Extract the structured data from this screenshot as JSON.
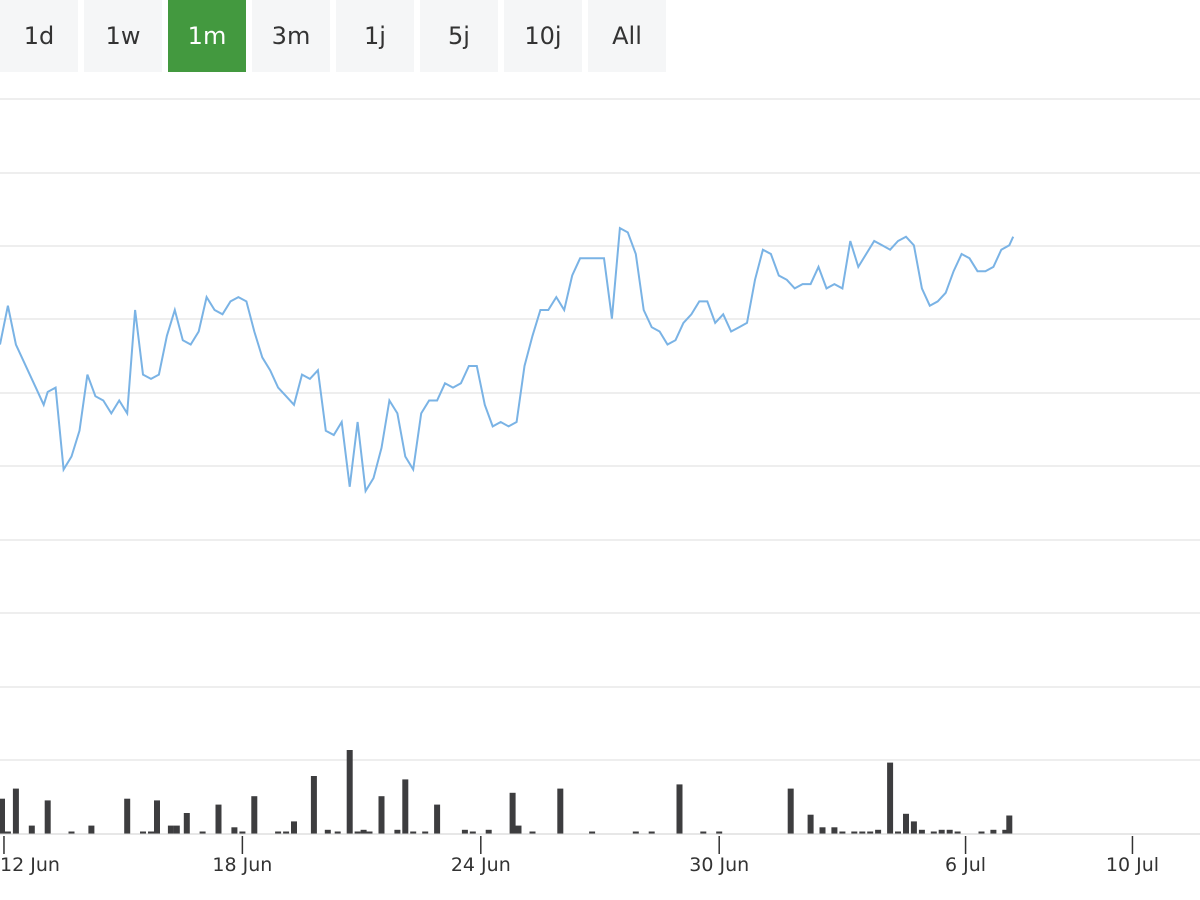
{
  "range_selector": {
    "buttons": [
      "1d",
      "1w",
      "1m",
      "3m",
      "1j",
      "5j",
      "10j",
      "All"
    ],
    "selected": "1m"
  },
  "colors": {
    "line": "#7ab3e5",
    "volume": "#3d3d3f",
    "selected_button": "#43993f",
    "button_bg": "#f5f6f7",
    "grid": "#e4e4e4"
  },
  "chart_data": [
    {
      "type": "line",
      "x_unit": "day",
      "xlim": [
        11.9,
        42.1
      ],
      "ylim": [
        0,
        10
      ],
      "grid": true,
      "x_ticks": [
        {
          "day": 12,
          "label": "12 Jun"
        },
        {
          "day": 18,
          "label": "18 Jun"
        },
        {
          "day": 24,
          "label": "24 Jun"
        },
        {
          "day": 30,
          "label": "30 Jun"
        },
        {
          "day": 36.2,
          "label": "6 Jul"
        },
        {
          "day": 40.4,
          "label": "10 Jul"
        }
      ],
      "series": [
        {
          "points": [
            [
              11.9,
              6.3
            ],
            [
              12.1,
              7.2
            ],
            [
              12.3,
              6.3
            ],
            [
              12.6,
              5.7
            ],
            [
              12.8,
              5.3
            ],
            [
              13.0,
              4.9
            ],
            [
              13.1,
              5.2
            ],
            [
              13.3,
              5.3
            ],
            [
              13.5,
              3.4
            ],
            [
              13.7,
              3.7
            ],
            [
              13.9,
              4.3
            ],
            [
              14.1,
              5.6
            ],
            [
              14.3,
              5.1
            ],
            [
              14.5,
              5.0
            ],
            [
              14.7,
              4.7
            ],
            [
              14.9,
              5.0
            ],
            [
              15.1,
              4.7
            ],
            [
              15.3,
              7.1
            ],
            [
              15.5,
              5.6
            ],
            [
              15.7,
              5.5
            ],
            [
              15.9,
              5.6
            ],
            [
              16.1,
              6.5
            ],
            [
              16.3,
              7.1
            ],
            [
              16.5,
              6.4
            ],
            [
              16.7,
              6.3
            ],
            [
              16.9,
              6.6
            ],
            [
              17.1,
              7.4
            ],
            [
              17.3,
              7.1
            ],
            [
              17.5,
              7.0
            ],
            [
              17.7,
              7.3
            ],
            [
              17.9,
              7.4
            ],
            [
              18.1,
              7.3
            ],
            [
              18.3,
              6.6
            ],
            [
              18.5,
              6.0
            ],
            [
              18.7,
              5.7
            ],
            [
              18.9,
              5.3
            ],
            [
              19.1,
              5.1
            ],
            [
              19.3,
              4.9
            ],
            [
              19.5,
              5.6
            ],
            [
              19.7,
              5.5
            ],
            [
              19.9,
              5.7
            ],
            [
              20.1,
              4.3
            ],
            [
              20.3,
              4.2
            ],
            [
              20.5,
              4.5
            ],
            [
              20.7,
              3.0
            ],
            [
              20.9,
              4.5
            ],
            [
              21.1,
              2.9
            ],
            [
              21.3,
              3.2
            ],
            [
              21.5,
              3.9
            ],
            [
              21.7,
              5.0
            ],
            [
              21.9,
              4.7
            ],
            [
              22.1,
              3.7
            ],
            [
              22.3,
              3.4
            ],
            [
              22.5,
              4.7
            ],
            [
              22.7,
              5.0
            ],
            [
              22.9,
              5.0
            ],
            [
              23.1,
              5.4
            ],
            [
              23.3,
              5.3
            ],
            [
              23.5,
              5.4
            ],
            [
              23.7,
              5.8
            ],
            [
              23.9,
              5.8
            ],
            [
              24.1,
              4.9
            ],
            [
              24.3,
              4.4
            ],
            [
              24.5,
              4.5
            ],
            [
              24.7,
              4.4
            ],
            [
              24.9,
              4.5
            ],
            [
              25.1,
              5.8
            ],
            [
              25.3,
              6.5
            ],
            [
              25.5,
              7.1
            ],
            [
              25.7,
              7.1
            ],
            [
              25.9,
              7.4
            ],
            [
              26.1,
              7.1
            ],
            [
              26.3,
              7.9
            ],
            [
              26.5,
              8.3
            ],
            [
              26.7,
              8.3
            ],
            [
              26.9,
              8.3
            ],
            [
              27.1,
              8.3
            ],
            [
              27.3,
              6.9
            ],
            [
              27.5,
              9.0
            ],
            [
              27.7,
              8.9
            ],
            [
              27.9,
              8.4
            ],
            [
              28.1,
              7.1
            ],
            [
              28.3,
              6.7
            ],
            [
              28.5,
              6.6
            ],
            [
              28.7,
              6.3
            ],
            [
              28.9,
              6.4
            ],
            [
              29.1,
              6.8
            ],
            [
              29.3,
              7.0
            ],
            [
              29.5,
              7.3
            ],
            [
              29.7,
              7.3
            ],
            [
              29.9,
              6.8
            ],
            [
              30.1,
              7.0
            ],
            [
              30.3,
              6.6
            ],
            [
              30.5,
              6.7
            ],
            [
              30.7,
              6.8
            ],
            [
              30.9,
              7.8
            ],
            [
              31.1,
              8.5
            ],
            [
              31.3,
              8.4
            ],
            [
              31.5,
              7.9
            ],
            [
              31.7,
              7.8
            ],
            [
              31.9,
              7.6
            ],
            [
              32.1,
              7.7
            ],
            [
              32.3,
              7.7
            ],
            [
              32.5,
              8.1
            ],
            [
              32.7,
              7.6
            ],
            [
              32.9,
              7.7
            ],
            [
              33.1,
              7.6
            ],
            [
              33.3,
              8.7
            ],
            [
              33.5,
              8.1
            ],
            [
              33.7,
              8.4
            ],
            [
              33.9,
              8.7
            ],
            [
              34.1,
              8.6
            ],
            [
              34.3,
              8.5
            ],
            [
              34.5,
              8.7
            ],
            [
              34.7,
              8.8
            ],
            [
              34.9,
              8.6
            ],
            [
              35.1,
              7.6
            ],
            [
              35.3,
              7.2
            ],
            [
              35.5,
              7.3
            ],
            [
              35.7,
              7.5
            ],
            [
              35.9,
              8.0
            ],
            [
              36.1,
              8.4
            ],
            [
              36.3,
              8.3
            ],
            [
              36.5,
              8.0
            ],
            [
              36.7,
              8.0
            ],
            [
              36.9,
              8.1
            ],
            [
              37.1,
              8.5
            ],
            [
              37.3,
              8.6
            ],
            [
              37.4,
              8.8
            ]
          ]
        }
      ]
    },
    {
      "type": "bar",
      "x_unit": "day",
      "xlim": [
        11.9,
        42.1
      ],
      "ylim": [
        0,
        10
      ],
      "series": [
        {
          "points": [
            [
              11.95,
              4.2
            ],
            [
              12.05,
              0.3
            ],
            [
              12.1,
              0.3
            ],
            [
              12.3,
              5.4
            ],
            [
              12.7,
              1.0
            ],
            [
              13.1,
              4.0
            ],
            [
              13.7,
              0.3
            ],
            [
              14.2,
              1.0
            ],
            [
              15.1,
              4.2
            ],
            [
              15.5,
              0.3
            ],
            [
              15.7,
              0.3
            ],
            [
              15.85,
              4.0
            ],
            [
              16.2,
              1.0
            ],
            [
              16.35,
              1.0
            ],
            [
              16.6,
              2.5
            ],
            [
              17.0,
              0.3
            ],
            [
              17.4,
              3.5
            ],
            [
              17.8,
              0.8
            ],
            [
              18.0,
              0.3
            ],
            [
              18.3,
              4.5
            ],
            [
              18.9,
              0.3
            ],
            [
              19.1,
              0.3
            ],
            [
              19.3,
              1.5
            ],
            [
              19.8,
              6.9
            ],
            [
              20.15,
              0.5
            ],
            [
              20.4,
              0.3
            ],
            [
              20.7,
              10.0
            ],
            [
              20.9,
              0.3
            ],
            [
              21.05,
              0.5
            ],
            [
              21.2,
              0.3
            ],
            [
              21.5,
              4.5
            ],
            [
              21.9,
              0.5
            ],
            [
              22.1,
              6.5
            ],
            [
              22.3,
              0.3
            ],
            [
              22.6,
              0.3
            ],
            [
              22.9,
              3.5
            ],
            [
              23.6,
              0.5
            ],
            [
              23.8,
              0.3
            ],
            [
              24.2,
              0.5
            ],
            [
              24.8,
              4.9
            ],
            [
              24.95,
              1.0
            ],
            [
              25.3,
              0.3
            ],
            [
              26.0,
              5.4
            ],
            [
              26.8,
              0.3
            ],
            [
              27.9,
              0.3
            ],
            [
              28.3,
              0.3
            ],
            [
              29.0,
              5.9
            ],
            [
              29.6,
              0.3
            ],
            [
              30.0,
              0.3
            ],
            [
              31.8,
              5.4
            ],
            [
              32.3,
              2.3
            ],
            [
              32.6,
              0.8
            ],
            [
              32.9,
              0.8
            ],
            [
              33.1,
              0.3
            ],
            [
              33.4,
              0.3
            ],
            [
              33.6,
              0.3
            ],
            [
              33.8,
              0.3
            ],
            [
              34.0,
              0.5
            ],
            [
              34.3,
              8.5
            ],
            [
              34.5,
              0.3
            ],
            [
              34.7,
              2.4
            ],
            [
              34.9,
              1.5
            ],
            [
              35.1,
              0.5
            ],
            [
              35.4,
              0.3
            ],
            [
              35.6,
              0.5
            ],
            [
              35.8,
              0.5
            ],
            [
              36.0,
              0.3
            ],
            [
              36.6,
              0.3
            ],
            [
              36.9,
              0.5
            ],
            [
              37.2,
              0.5
            ],
            [
              37.3,
              2.2
            ]
          ]
        }
      ]
    }
  ]
}
